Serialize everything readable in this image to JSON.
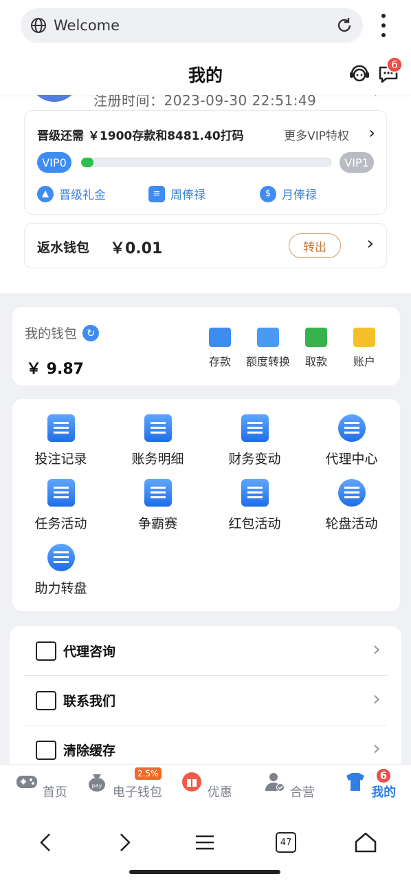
{
  "browser": {
    "url_text": "Welcome",
    "tab_count": "47"
  },
  "header": {
    "title": "我的",
    "message_badge": "6"
  },
  "profile": {
    "reg_line": "注册时间：2023-09-30 22:51:49"
  },
  "vip": {
    "need_text": "晋级还需 ￥1900存款和8481.40打码",
    "more_label": "更多VIP特权",
    "current_level": "VIP0",
    "next_level": "VIP1",
    "progress_percent": 5,
    "perks": [
      "晋级礼金",
      "周俸禄",
      "月俸禄"
    ]
  },
  "rebate": {
    "label": "返水钱包",
    "amount": "￥0.01",
    "transfer_label": "转出"
  },
  "wallet": {
    "title": "我的钱包",
    "balance": "￥ 9.87",
    "actions": [
      "存款",
      "额度转换",
      "取款",
      "账户"
    ]
  },
  "grid": {
    "items": [
      "投注记录",
      "账务明细",
      "财务变动",
      "代理中心",
      "任务活动",
      "争霸赛",
      "红包活动",
      "轮盘活动",
      "助力转盘"
    ]
  },
  "menu": {
    "items": [
      "代理咨询",
      "联系我们",
      "清除缓存"
    ]
  },
  "bottom_nav": {
    "items": [
      "首页",
      "电子钱包",
      "优惠",
      "合营",
      "我的"
    ],
    "wallet_badge": "2.5%",
    "mine_badge": "6",
    "mine_icon_number": "8"
  },
  "colors": {
    "accent": "#2f7fe6",
    "badge": "#ef4b47",
    "progress": "#2fbf4c",
    "transfer": "#c5763a"
  }
}
